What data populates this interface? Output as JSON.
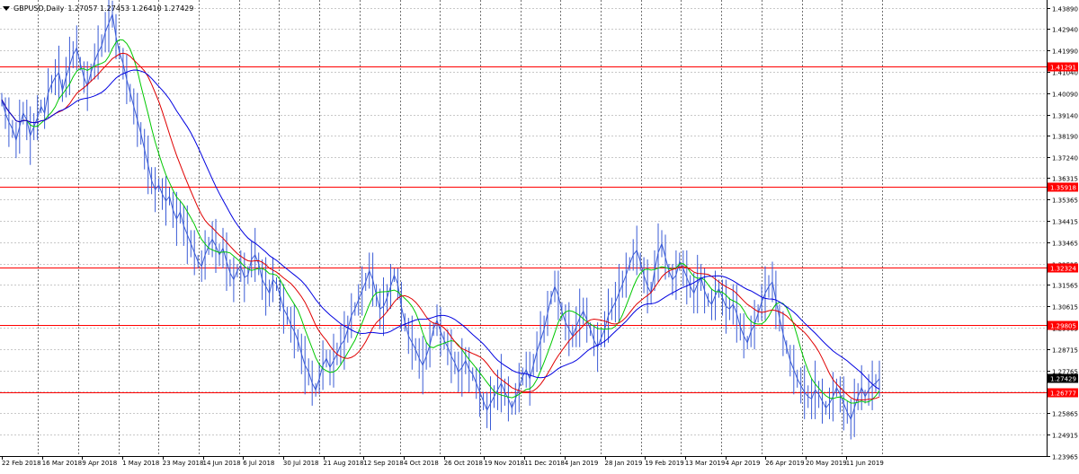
{
  "header": {
    "symbol_label": "GBPUSD,Daily",
    "ohlc_label": "1.27057 1.27453 1.26410 1.27429"
  },
  "colors": {
    "background": "#ffffff",
    "grid": "#c8c8c8",
    "price_line": "#3a5bd6",
    "ma_green": "#00c800",
    "ma_red": "#e00000",
    "ma_blue": "#0000e0",
    "level_line": "#ff0000",
    "level_label_bg": "#ff0000",
    "current_label_bg": "#000000"
  },
  "chart_data": {
    "type": "line",
    "title": "GBPUSD,Daily",
    "ohlc": {
      "open": 1.27057,
      "high": 1.27453,
      "low": 1.2641,
      "close": 1.27429
    },
    "ylim": [
      1.2396,
      1.4423
    ],
    "y_ticks": [
      "1.43890",
      "1.42940",
      "1.41990",
      "1.41040",
      "1.40090",
      "1.39140",
      "1.38190",
      "1.37240",
      "1.36315",
      "1.35365",
      "1.34415",
      "1.33465",
      "1.32515",
      "1.31565",
      "1.30615",
      "1.29665",
      "1.28715",
      "1.27765",
      "1.26815",
      "1.25865",
      "1.24915",
      "1.23965"
    ],
    "y_tick_values": [
      1.4389,
      1.4294,
      1.4199,
      1.4104,
      1.4009,
      1.3914,
      1.3819,
      1.3724,
      1.36315,
      1.35365,
      1.34415,
      1.33465,
      1.32515,
      1.31565,
      1.30615,
      1.29665,
      1.28715,
      1.27765,
      1.26815,
      1.25865,
      1.24915,
      1.23965
    ],
    "x_ticks": [
      "22 Feb 2018",
      "16 Mar 2018",
      "9 Apr 2018",
      "1 May 2018",
      "23 May 2018",
      "14 Jun 2018",
      "6 Jul 2018",
      "30 Jul 2018",
      "21 Aug 2018",
      "12 Sep 2018",
      "4 Oct 2018",
      "26 Oct 2018",
      "19 Nov 2018",
      "11 Dec 2018",
      "4 Jan 2019",
      "28 Jan 2019",
      "19 Feb 2019",
      "13 Mar 2019",
      "4 Apr 2019",
      "26 Apr 2019",
      "20 May 2019",
      "11 Jun 2019"
    ],
    "levels": [
      1.41291,
      1.35918,
      1.32324,
      1.29805,
      1.26777
    ],
    "level_labels": [
      "1.41291",
      "1.35918",
      "1.32324",
      "1.29805",
      "1.26777"
    ],
    "current_price": 1.27429,
    "current_price_label": "1.27429",
    "grid": true,
    "series": [
      {
        "values": [
          1.398,
          1.392,
          1.388,
          1.385,
          1.38,
          1.386,
          1.392,
          1.389,
          1.382,
          1.386,
          1.39,
          1.395,
          1.392,
          1.401,
          1.405,
          1.408,
          1.41,
          1.402,
          1.408,
          1.413,
          1.418,
          1.421,
          1.414,
          1.408,
          1.404,
          1.41,
          1.415,
          1.419,
          1.422,
          1.428,
          1.432,
          1.436,
          1.426,
          1.419,
          1.414,
          1.407,
          1.401,
          1.395,
          1.389,
          1.383,
          1.376,
          1.369,
          1.362,
          1.358,
          1.36,
          1.356,
          1.353,
          1.355,
          1.349,
          1.345,
          1.348,
          1.342,
          1.338,
          1.334,
          1.33,
          1.326,
          1.324,
          1.329,
          1.333,
          1.336,
          1.333,
          1.329,
          1.332,
          1.326,
          1.321,
          1.318,
          1.322,
          1.324,
          1.319,
          1.32,
          1.327,
          1.329,
          1.325,
          1.318,
          1.315,
          1.312,
          1.318,
          1.316,
          1.311,
          1.305,
          1.302,
          1.298,
          1.295,
          1.291,
          1.285,
          1.28,
          1.277,
          1.272,
          1.269,
          1.274,
          1.28,
          1.283,
          1.279,
          1.282,
          1.285,
          1.289,
          1.291,
          1.296,
          1.302,
          1.305,
          1.309,
          1.313,
          1.317,
          1.322,
          1.318,
          1.311,
          1.305,
          1.306,
          1.31,
          1.315,
          1.32,
          1.316,
          1.306,
          1.299,
          1.293,
          1.29,
          1.287,
          1.283,
          1.28,
          1.284,
          1.289,
          1.296,
          1.3,
          1.295,
          1.291,
          1.288,
          1.284,
          1.281,
          1.277,
          1.279,
          1.282,
          1.278,
          1.276,
          1.272,
          1.268,
          1.264,
          1.26,
          1.263,
          1.266,
          1.269,
          1.272,
          1.268,
          1.265,
          1.261,
          1.265,
          1.27,
          1.275,
          1.278,
          1.274,
          1.28,
          1.286,
          1.291,
          1.296,
          1.303,
          1.31,
          1.315,
          1.311,
          1.304,
          1.299,
          1.296,
          1.293,
          1.297,
          1.301,
          1.304,
          1.3,
          1.296,
          1.291,
          1.288,
          1.292,
          1.296,
          1.302,
          1.305,
          1.308,
          1.312,
          1.316,
          1.32,
          1.325,
          1.329,
          1.331,
          1.326,
          1.32,
          1.315,
          1.312,
          1.322,
          1.33,
          1.334,
          1.328,
          1.322,
          1.318,
          1.32,
          1.326,
          1.323,
          1.319,
          1.315,
          1.312,
          1.316,
          1.319,
          1.313,
          1.309,
          1.307,
          1.311,
          1.314,
          1.31,
          1.306,
          1.305,
          1.307,
          1.303,
          1.297,
          1.293,
          1.29,
          1.295,
          1.298,
          1.303,
          1.308,
          1.312,
          1.315,
          1.317,
          1.309,
          1.301,
          1.294,
          1.288,
          1.282,
          1.278,
          1.274,
          1.271,
          1.268,
          1.266,
          1.265,
          1.269,
          1.267,
          1.264,
          1.261,
          1.263,
          1.266,
          1.27,
          1.267,
          1.263,
          1.259,
          1.256,
          1.261,
          1.266,
          1.27,
          1.266,
          1.269,
          1.271,
          1.272,
          1.274
        ]
      }
    ]
  }
}
